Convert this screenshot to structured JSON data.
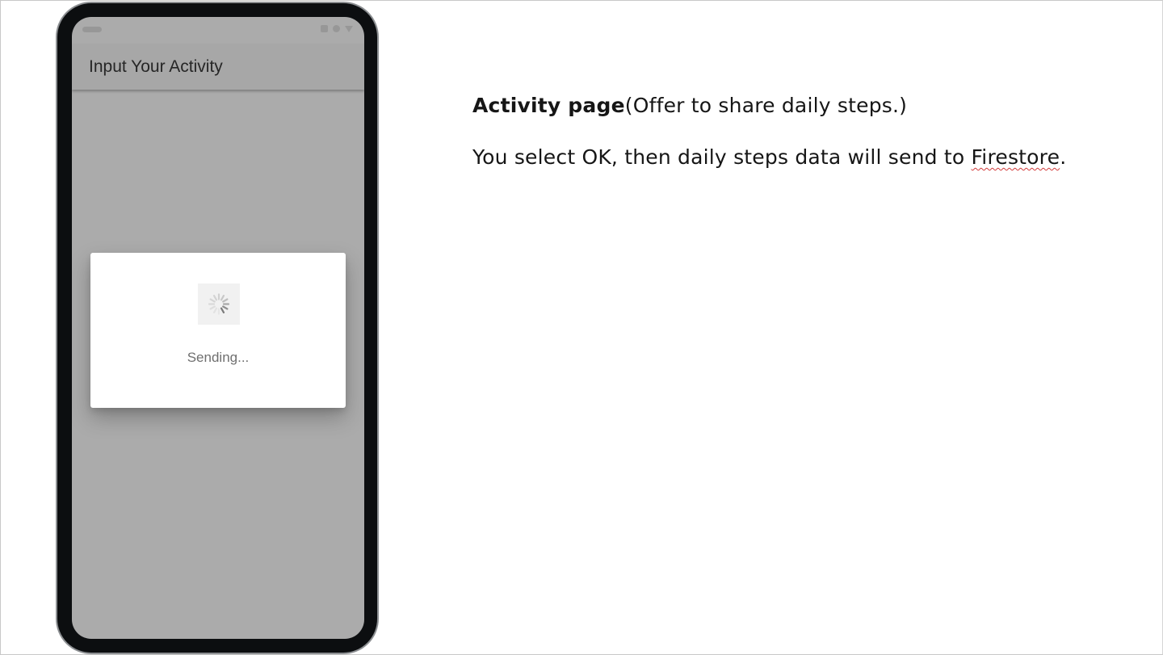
{
  "app": {
    "title": "Input Your Activity"
  },
  "dialog": {
    "status_text": "Sending..."
  },
  "description": {
    "heading_bold": "Activity page",
    "heading_rest": "(Offer to share daily steps.)",
    "body_prefix": "You select OK, then daily steps data will send to ",
    "body_link": "Firestore",
    "body_suffix": "."
  },
  "icons": {
    "status_left": "status-pill-icon",
    "status_right": [
      "square-icon",
      "circle-icon",
      "triangle-icon"
    ],
    "spinner": "loading-spinner-icon"
  },
  "colors": {
    "screen_overlay": "#ababab",
    "phone_body": "#0c0e10",
    "dialog_bg": "#ffffff",
    "dialog_text": "#6f6f6f",
    "spell_underline": "#d23b3b"
  }
}
